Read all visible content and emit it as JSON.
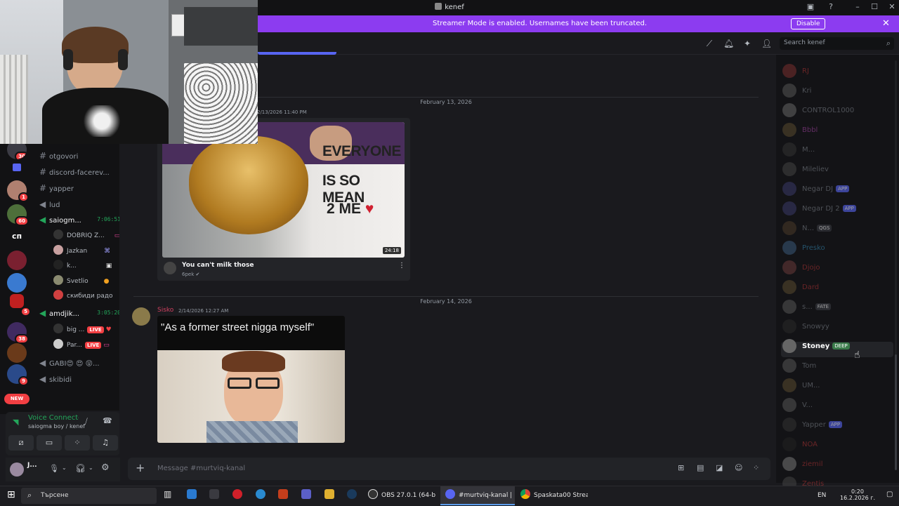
{
  "window": {
    "title": "kenef"
  },
  "banner": {
    "message": "Streamer Mode is enabled. Usernames have been truncated.",
    "disable_label": "Disable"
  },
  "header": {
    "search_placeholder": "Search kenef"
  },
  "rail": {
    "badges": [
      "30",
      "1",
      "60",
      "5",
      "38",
      "9"
    ],
    "text_server": "сп",
    "new_label": "NEW"
  },
  "channels": {
    "text": [
      "otgovori",
      "discord-facerev...",
      "yapper",
      "lud"
    ],
    "voice1": {
      "name": "saiogm...",
      "timer": "7:06:51",
      "users": [
        "DOBRIQ Z...",
        "Jazkan",
        "k...",
        "Svetlio",
        "скибиди радо"
      ]
    },
    "voice2": {
      "name": "amdjik...",
      "timer": "3:05:20",
      "users": [
        "big ...",
        "Par..."
      ],
      "live_label": "LIVE"
    },
    "voice3": "GABI😍 😍 😝...",
    "voice4": "skibidi"
  },
  "voice_panel": {
    "status": "Voice Connected",
    "location": "saiogma boy / kenef"
  },
  "user_panel": {
    "name": "J..."
  },
  "chat": {
    "date1": "February 13, 2026",
    "msg1_time": "2/13/2026 11:40 PM",
    "video": {
      "title": "You can't milk those",
      "channel": "6pek",
      "duration": "24:18",
      "overlay_text_1": "EVERYONE",
      "overlay_text_2": "IS SO MEAN",
      "overlay_text_3": "2 ME"
    },
    "date2": "February 14, 2026",
    "msg2": {
      "author": "Sisko",
      "time": "2/14/2026 12:27 AM",
      "meme_caption": "\"As a former street nigga myself\""
    },
    "composer_placeholder": "Message #murtviq-kanal"
  },
  "members": [
    {
      "name": "RJ",
      "color": "#d23a3a"
    },
    {
      "name": "Kri",
      "color": "#949ba4"
    },
    {
      "name": "CONTROL1000",
      "color": "#949ba4"
    },
    {
      "name": "Bbbl",
      "color": "#c24dc2"
    },
    {
      "name": "M...",
      "color": "#949ba4"
    },
    {
      "name": "Mileliev",
      "color": "#949ba4"
    },
    {
      "name": "Negar DJ",
      "color": "#949ba4",
      "tag": "APP"
    },
    {
      "name": "Negar DJ 2",
      "color": "#949ba4",
      "tag": "APP"
    },
    {
      "name": "N...",
      "color": "#949ba4",
      "tag": "QGS"
    },
    {
      "name": "Presko",
      "color": "#3aa0d2"
    },
    {
      "name": "Djojo",
      "color": "#d23a3a"
    },
    {
      "name": "Dard",
      "color": "#d23a3a"
    },
    {
      "name": "s...",
      "color": "#949ba4",
      "tag": "FATE"
    },
    {
      "name": "Snowyy",
      "color": "#949ba4"
    },
    {
      "name": "Stoney",
      "color": "#ffffff",
      "tag": "DEEP"
    },
    {
      "name": "Tom",
      "color": "#949ba4"
    },
    {
      "name": "UM...",
      "color": "#949ba4"
    },
    {
      "name": "V...",
      "color": "#949ba4"
    },
    {
      "name": "Yapper",
      "color": "#949ba4",
      "tag": "APP"
    },
    {
      "name": "NOA",
      "color": "#d23a3a"
    },
    {
      "name": "ziemil",
      "color": "#d23a3a"
    },
    {
      "name": "Zentis",
      "color": "#d23a3a"
    }
  ],
  "taskbar": {
    "search": "Търсене",
    "apps": [
      "OBS 27.0.1 (64-bit, ...",
      "#murtviq-kanal | ke...",
      "Spaskata00 Stream ..."
    ],
    "lang": "EN",
    "time": "0:20",
    "date": "16.2.2026 г."
  }
}
